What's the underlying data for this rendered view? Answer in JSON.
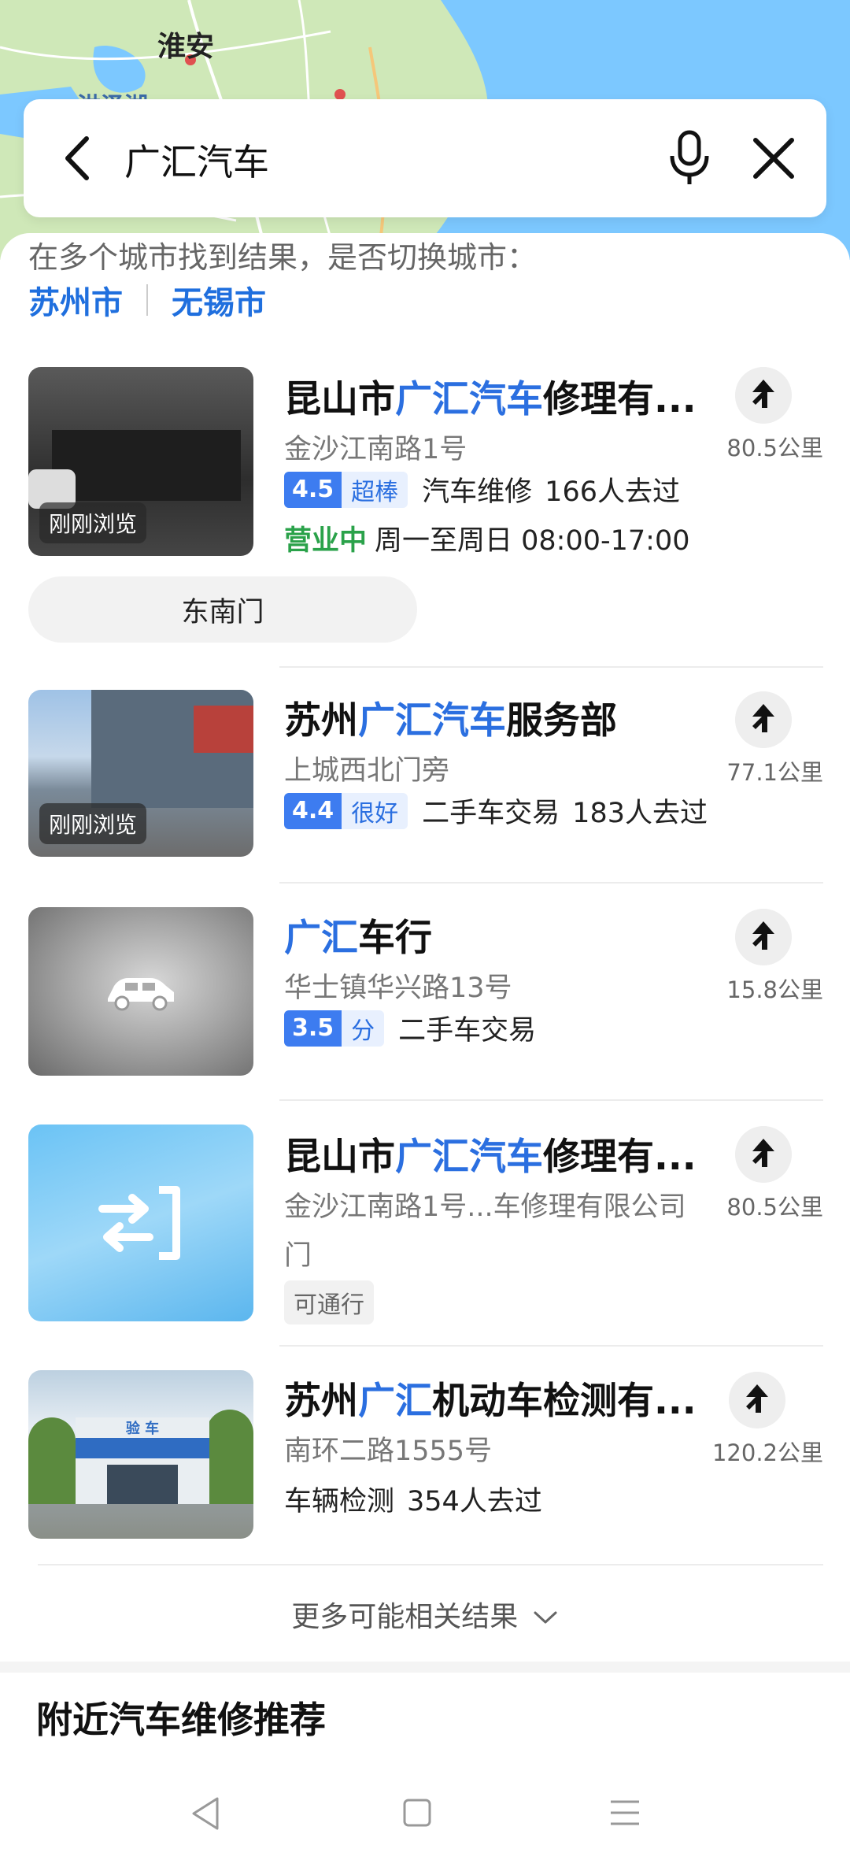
{
  "map": {
    "city_label_1": "淮安",
    "city_label_2": "洪泽湖"
  },
  "search": {
    "query": "广汇汽车"
  },
  "hint": {
    "text": "在多个城市找到结果，是否切换城市：",
    "cities": [
      "苏州市",
      "无锡市"
    ]
  },
  "results": [
    {
      "title_pre": "昆山市",
      "title_hl": "广汇汽车",
      "title_post": "修理有...",
      "address": "金沙江南路1号",
      "rating_score": "4.5",
      "rating_label": "超棒",
      "category": "汽车维修",
      "visits": "166人去过",
      "status": "营业中",
      "hours": "周一至周日 08:00-17:00",
      "distance": "80.5公里",
      "thumb_tag": "刚刚浏览",
      "sub_entrance": "东南门"
    },
    {
      "title_pre": "苏州",
      "title_hl": "广汇汽车",
      "title_post": "服务部",
      "address": "上城西北门旁",
      "rating_score": "4.4",
      "rating_label": "很好",
      "category": "二手车交易",
      "visits": "183人去过",
      "distance": "77.1公里",
      "thumb_tag": "刚刚浏览"
    },
    {
      "title_pre": "",
      "title_hl": "广汇",
      "title_post": "车行",
      "address": "华士镇华兴路13号",
      "rating_score": "3.5",
      "rating_label": "分",
      "category": "二手车交易",
      "distance": "15.8公里"
    },
    {
      "title_pre": "昆山市",
      "title_hl": "广汇汽车",
      "title_post": "修理有...",
      "address_line1": "金沙江南路1号...车修理有限公司",
      "address_line2": "门",
      "tag": "可通行",
      "distance": "80.5公里"
    },
    {
      "title_pre": "苏州",
      "title_hl": "广汇",
      "title_post": "机动车检测有...",
      "address": "南环二路1555号",
      "category": "车辆检测",
      "visits": "354人去过",
      "distance": "120.2公里",
      "sign_text": "验 车"
    }
  ],
  "more_results": "更多可能相关结果",
  "nearby_title": "附近汽车维修推荐",
  "colors": {
    "accent": "#2b6fe0",
    "open_green": "#2aa24a",
    "rating_blue": "#3d7cf0"
  },
  "icons": [
    "back-icon",
    "mic-icon",
    "close-icon",
    "navigate-arrow-icon",
    "swap-icon",
    "car-icon",
    "chevron-down-icon",
    "nav-back-icon",
    "nav-home-icon",
    "nav-menu-icon"
  ]
}
